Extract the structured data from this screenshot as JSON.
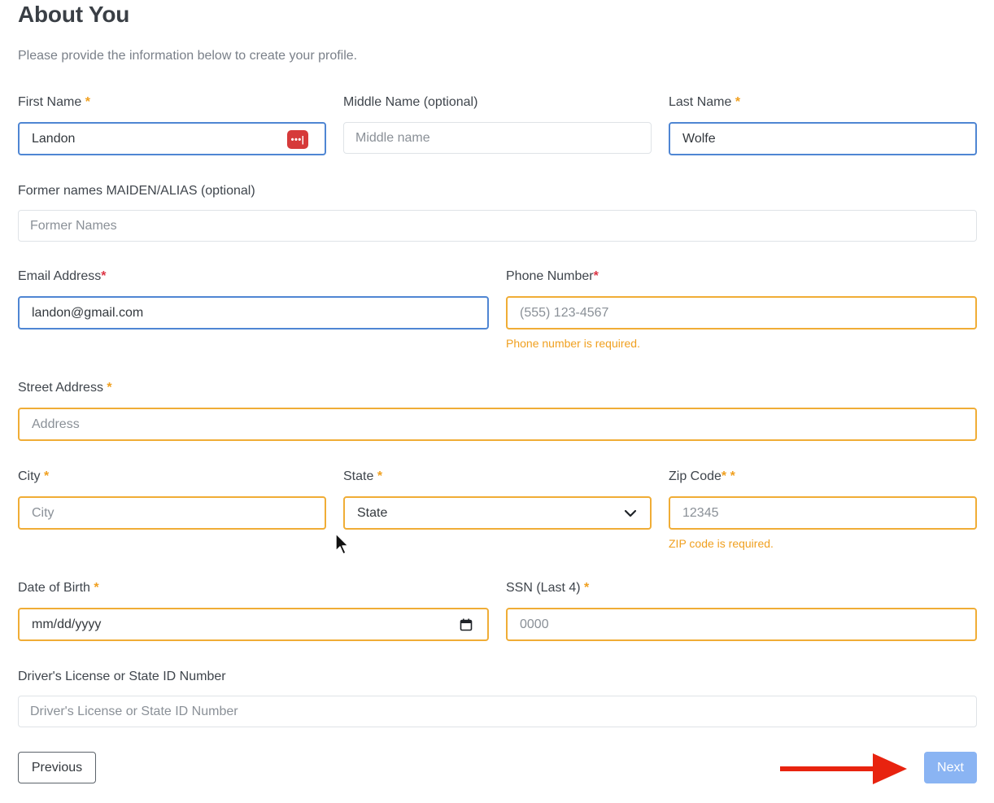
{
  "header": {
    "title": "About You",
    "subtitle": "Please provide the information below to create your profile."
  },
  "form": {
    "first_name": {
      "label": "First Name",
      "required_mark": "*",
      "value": "Landon"
    },
    "middle_name": {
      "label": "Middle Name (optional)",
      "placeholder": "Middle name"
    },
    "last_name": {
      "label": "Last Name",
      "required_mark": "*",
      "value": "Wolfe"
    },
    "former_names": {
      "label": "Former names MAIDEN/ALIAS (optional)",
      "placeholder": "Former Names"
    },
    "email": {
      "label": "Email Address",
      "required_mark": "*",
      "value": "landon@gmail.com"
    },
    "phone": {
      "label": "Phone Number",
      "required_mark": "*",
      "placeholder": "(555) 123-4567",
      "error": "Phone number is required."
    },
    "street": {
      "label": "Street Address",
      "required_mark": "*",
      "placeholder": "Address"
    },
    "city": {
      "label": "City",
      "required_mark": "*",
      "placeholder": "City"
    },
    "state": {
      "label": "State",
      "required_mark": "*",
      "selected": "State"
    },
    "zip": {
      "label": "Zip Code",
      "required_mark": "*",
      "required_mark_2": "*",
      "placeholder": "12345",
      "error": "ZIP code is required."
    },
    "dob": {
      "label": "Date of Birth",
      "required_mark": "*",
      "placeholder": "mm/dd/yyyy"
    },
    "ssn": {
      "label": "SSN (Last 4)",
      "required_mark": "*",
      "placeholder": "0000"
    },
    "license": {
      "label": "Driver's License or State ID Number",
      "placeholder": "Driver's License or State ID Number"
    }
  },
  "buttons": {
    "previous_label": "Previous",
    "next_label": "Next"
  },
  "icons": {
    "password_manager": "password-manager-icon",
    "select_arrow": "chevron-down-icon",
    "calendar": "calendar-icon",
    "pointer": "mouse-pointer-icon",
    "annotation": "red-arrow-icon"
  },
  "colors": {
    "focus_blue": "#4f86d3",
    "invalid_orange": "#f0ad36",
    "required_star": "#f0a020",
    "next_button": "#8ab4f3",
    "annotation_red": "#e8230f"
  }
}
